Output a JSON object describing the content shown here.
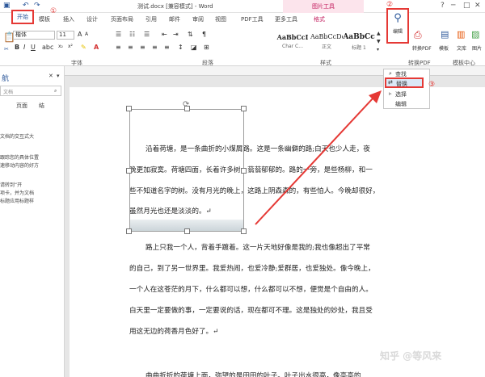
{
  "titlebar": {
    "title": "测试.docx [兼容模式] - Word",
    "context_tab_group": "图片工具",
    "win_buttons": [
      "?",
      "─",
      "□",
      "✕"
    ]
  },
  "tabs": {
    "home": "开始",
    "items": [
      "模板",
      "插入",
      "设计",
      "页面布局",
      "引用",
      "邮件",
      "审阅",
      "视图",
      "PDF工具",
      "更多工具",
      "格式"
    ]
  },
  "ribbon": {
    "font_name": "楷体",
    "font_size": "11",
    "font_group": "字体",
    "paragraph_group": "段落",
    "styles_group": "样式",
    "convert_group": "转换PDF",
    "template_center": "模板中心",
    "styles": [
      {
        "preview": "AaBbCcI",
        "name": "Char C..."
      },
      {
        "preview": "AaBbCcDc",
        "name": "正文"
      },
      {
        "preview": "AaBbCc",
        "name": "标题 1"
      }
    ],
    "edit_label": "编辑",
    "convert_pdf": "转换PDF",
    "template": "模板",
    "library": "文库",
    "image": "图片"
  },
  "navpane": {
    "title": "航",
    "search_placeholder": "文档",
    "tabs": [
      "页面",
      "结"
    ],
    "lines": [
      "文档的交互式大",
      "跟踪您的具体位置",
      "速移动内容的好方",
      "请转到“开",
      "项卡，并为文档",
      "标题应用标题样"
    ]
  },
  "popup": {
    "find": "查找",
    "replace": "替换",
    "select": "选择",
    "edit": "编辑"
  },
  "markers": [
    "①",
    "②",
    "③"
  ],
  "document": {
    "paragraphs": [
      "沿着荷塘，是一条曲折的小煤屑路。这是一条幽僻的路;白天也少人走，夜",
      "晚更加寂寞。荷塘四面，长着许多树，蓊蓊郁郁的。路的一旁，是些杨柳，和一",
      "些不知道名字的树。没有月光的晚上，这路上阴森森的，有些怕人。今晚却很好，",
      "虽然月光也还是淡淡的。↵",
      "路上只我一个人，背着手踱着。这一片天地好像是我的;我也像超出了平常",
      "的自己，到了另一世界里。我爱热闹，也爱冷静;爱群居，也爱独处。像今晚上，",
      "一个人在这苍茫的月下，什么都可以想，什么都可以不想，便觉是个自由的人。",
      "白天里一定要做的事，一定要说的话，现在都可不理。这是独处的妙处，我且受",
      "用这无边的荷香月色好了。↵",
      "曲曲折折的荷塘上面，弥望的是田田的叶子。叶子出水很高，像亭亭的"
    ]
  },
  "watermark": "知乎 @等风来",
  "colors": {
    "accent": "#2b579a",
    "highlight": "#e53935",
    "context_tab": "#c2185b"
  }
}
